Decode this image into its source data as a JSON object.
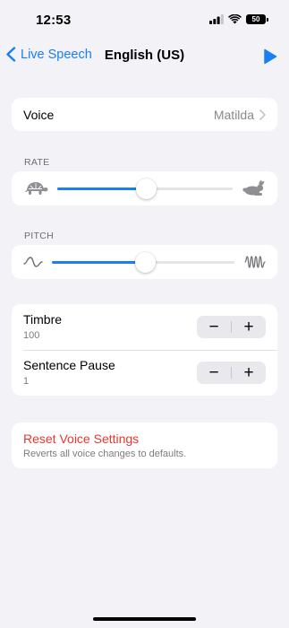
{
  "status_bar": {
    "time": "12:53",
    "battery_level": "50",
    "icons": [
      "cellular-signal-icon",
      "wifi-icon",
      "battery-icon"
    ]
  },
  "nav": {
    "back_label": "Live Speech",
    "title": "English (US)",
    "play_icon": "play-icon"
  },
  "voice": {
    "label": "Voice",
    "value": "Matilda"
  },
  "rate": {
    "header": "RATE",
    "value_fraction": 0.51,
    "left_icon": "turtle-icon",
    "right_icon": "rabbit-icon"
  },
  "pitch": {
    "header": "PITCH",
    "value_fraction": 0.51,
    "left_icon": "low-wave-icon",
    "right_icon": "high-wave-icon"
  },
  "timbre": {
    "label": "Timbre",
    "value": "100",
    "minus": "−",
    "plus": "+"
  },
  "sentence_pause": {
    "label": "Sentence Pause",
    "value": "1",
    "minus": "−",
    "plus": "+"
  },
  "reset": {
    "title": "Reset Voice Settings",
    "subtitle": "Reverts all voice changes to defaults."
  },
  "colors": {
    "accent": "#1a7ef5",
    "destructive": "#f0342b",
    "background": "#f2f2f7",
    "secondary_text": "#8a8a8e"
  }
}
